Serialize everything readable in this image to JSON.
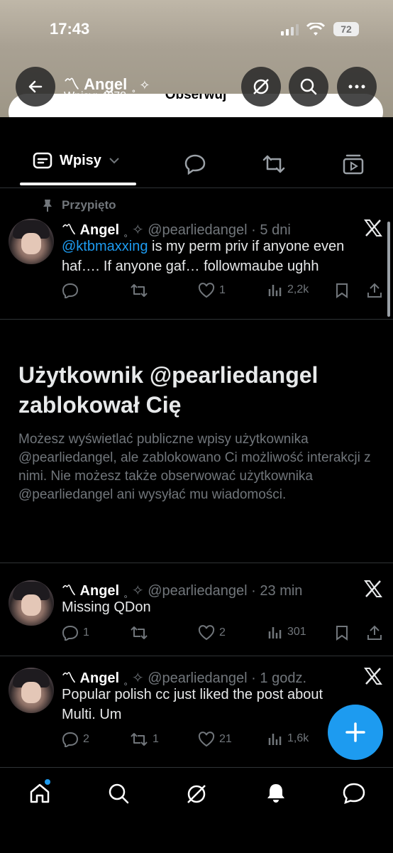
{
  "status_bar": {
    "time": "17:43",
    "battery": "72"
  },
  "profile": {
    "name": "〽 Angel",
    "sparkle": "˳ ✧",
    "posts_count": "Wpisy: 4278",
    "follow_label": "Obserwuj"
  },
  "tabs": {
    "active_label": "Wpisy"
  },
  "pinned": {
    "pinned_label": "Przypięto",
    "name": "〽 Angel",
    "handle": "˳ ✧ @pearliedangel · 5 dni",
    "mention": "@ktbmaxxing",
    "text": " is my perm priv if anyone even haf…. If anyone gaf… followmaube ughh",
    "likes": "1",
    "views": "2,2k"
  },
  "blocked": {
    "title": "Użytkownik @pearliedangel zablokował Cię",
    "text": "Możesz wyświetlać publiczne wpisy użytkownika @pearliedangel, ale zablokowano Ci możliwość interakcji z nimi. Nie możesz także obserwować użytkownika @pearliedangel ani wysyłać mu wiadomości."
  },
  "tweets": [
    {
      "name": "〽 Angel",
      "handle": "˳ ✧ @pearliedangel · 23 min",
      "text": "Missing QDon",
      "replies": "1",
      "reposts": "",
      "likes": "2",
      "views": "301"
    },
    {
      "name": "〽 Angel",
      "handle": "˳ ✧ @pearliedangel · 1 godz.",
      "text": "Popular polish cc just liked the post about Multi. Um",
      "replies": "2",
      "reposts": "1",
      "likes": "21",
      "views": "1,6k"
    }
  ],
  "icons": [
    "back-icon",
    "grok-icon",
    "search-icon",
    "more-icon",
    "posts-tab-icon",
    "chevron-down-icon",
    "replies-tab-icon",
    "reposts-tab-icon",
    "media-tab-icon",
    "pin-icon",
    "x-logo-icon",
    "reply-icon",
    "repost-icon",
    "like-icon",
    "views-icon",
    "bookmark-icon",
    "share-icon",
    "compose-icon",
    "home-icon",
    "explore-icon",
    "grok-nav-icon",
    "notifications-icon",
    "messages-icon"
  ],
  "colors": {
    "accent": "#1d9bf0",
    "muted": "#71767b",
    "background": "#000000",
    "text": "#e7e9ea"
  }
}
